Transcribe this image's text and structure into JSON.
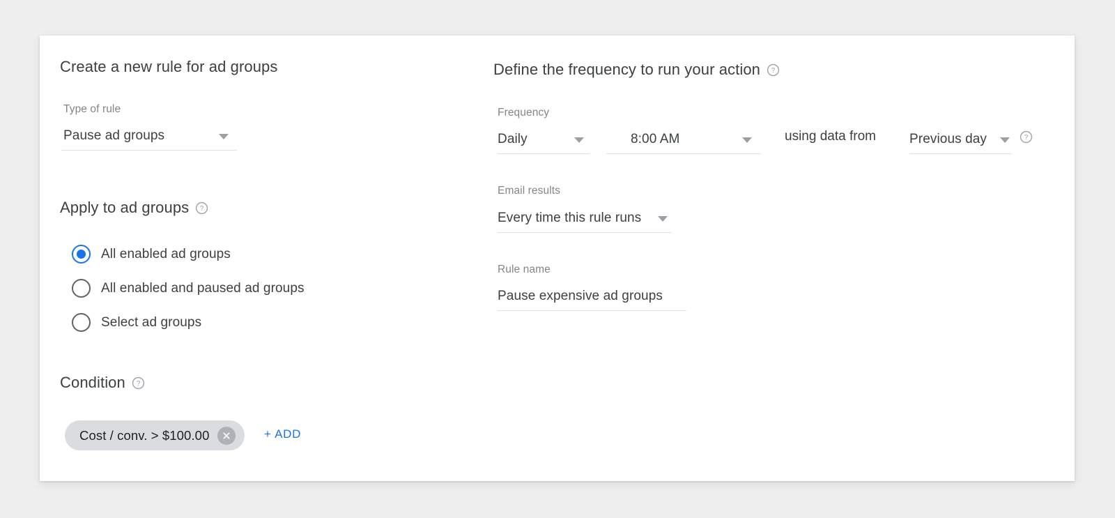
{
  "left_panel": {
    "title": "Create a new rule for ad groups",
    "type_of_rule": {
      "label": "Type of rule",
      "value": "Pause ad groups"
    },
    "apply_to": {
      "title": "Apply to ad groups",
      "help_icon": "help-circle-icon",
      "options": [
        {
          "label": "All enabled ad groups",
          "selected": true
        },
        {
          "label": "All enabled and paused ad groups",
          "selected": false
        },
        {
          "label": "Select ad groups",
          "selected": false
        }
      ]
    },
    "condition": {
      "title": "Condition",
      "help_icon": "help-circle-icon",
      "chips": [
        {
          "label": "Cost / conv. > $100.00",
          "remove_icon": "close-circle-icon"
        }
      ],
      "add_label": "+ ADD"
    }
  },
  "right_panel": {
    "title": "Define the frequency to run your action",
    "title_help_icon": "help-circle-icon",
    "frequency": {
      "label": "Frequency",
      "interval_value": "Daily",
      "time_value": "8:00 AM",
      "connector_text": "using data from",
      "data_from_value": "Previous day",
      "help_icon": "help-circle-icon"
    },
    "email_results": {
      "label": "Email results",
      "value": "Every time this rule runs"
    },
    "rule_name": {
      "label": "Rule name",
      "value": "Pause expensive ad groups"
    }
  },
  "icons": {
    "caret": "chevron-down-icon"
  },
  "colors": {
    "page_background": "#eeeeee",
    "card_background": "#ffffff",
    "accent_blue": "#1a73e8",
    "text_primary": "#3c4043",
    "text_secondary": "#80868b",
    "chip_background": "#dadce0",
    "underline": "#e0e0e0"
  }
}
